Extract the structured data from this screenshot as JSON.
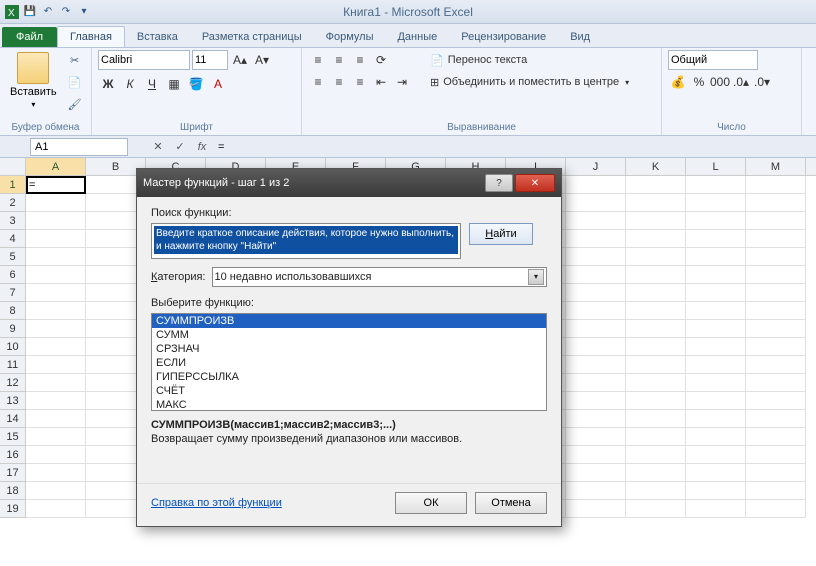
{
  "title": "Книга1 - Microsoft Excel",
  "qat": {
    "save": "💾",
    "undo": "↶",
    "redo": "↷"
  },
  "tabs": {
    "file": "Файл",
    "items": [
      "Главная",
      "Вставка",
      "Разметка страницы",
      "Формулы",
      "Данные",
      "Рецензирование",
      "Вид"
    ],
    "active": 0
  },
  "ribbon": {
    "clipboard": {
      "paste": "Вставить",
      "label": "Буфер обмена"
    },
    "font": {
      "name": "Calibri",
      "size": "11",
      "label": "Шрифт"
    },
    "align": {
      "wrap": "Перенос текста",
      "merge": "Объединить и поместить в центре",
      "label": "Выравнивание"
    },
    "number": {
      "format": "Общий",
      "label": "Число"
    }
  },
  "namebox": "A1",
  "formula": "=",
  "fb": {
    "cancel": "✕",
    "enter": "✓",
    "fx": "fx"
  },
  "cols": [
    "A",
    "B",
    "C",
    "D",
    "E",
    "F",
    "G",
    "H",
    "I",
    "J",
    "K",
    "L",
    "M"
  ],
  "rows": [
    "1",
    "2",
    "3",
    "4",
    "5",
    "6",
    "7",
    "8",
    "9",
    "10",
    "11",
    "12",
    "13",
    "14",
    "15",
    "16",
    "17",
    "18",
    "19"
  ],
  "activeCell": "=",
  "dialog": {
    "title": "Мастер функций - шаг 1 из 2",
    "searchLabel": "Поиск функции:",
    "searchText": "Введите краткое описание действия, которое нужно выполнить, и нажмите кнопку \"Найти\"",
    "findBtn": "Найти",
    "catLabel": "Категория:",
    "catUnderline": "К",
    "catRest": "атегория:",
    "catValue": "10 недавно использовавшихся",
    "selectLabel": "Выберите функцию:",
    "funcs": [
      "СУММПРОИЗВ",
      "СУММ",
      "СРЗНАЧ",
      "ЕСЛИ",
      "ГИПЕРССЫЛКА",
      "СЧЁТ",
      "МАКС"
    ],
    "sig": "СУММПРОИЗВ(массив1;массив2;массив3;...)",
    "desc": "Возвращает сумму произведений диапазонов или массивов.",
    "help": "Справка по этой функции",
    "ok": "ОК",
    "cancel": "Отмена"
  }
}
